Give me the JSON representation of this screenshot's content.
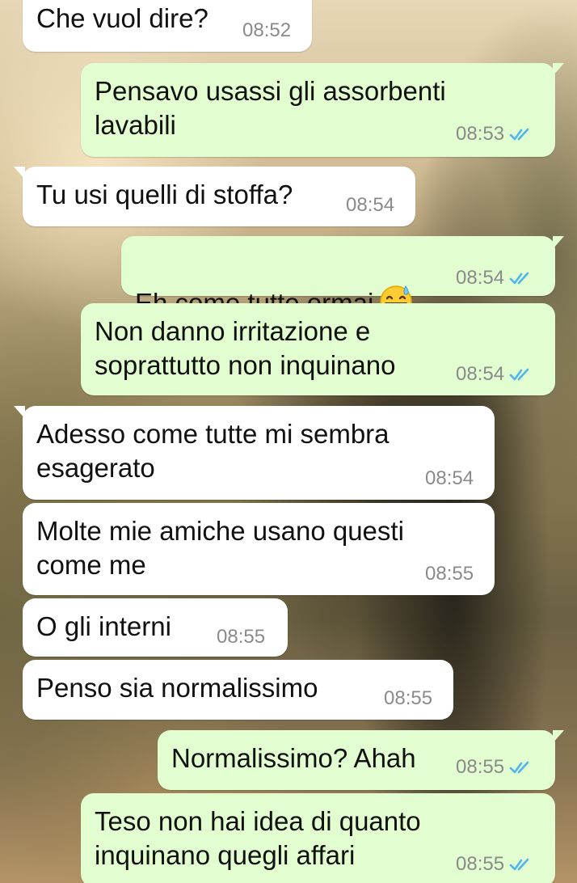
{
  "messages": [
    {
      "direction": "in",
      "text": "Che vuol dire?",
      "time": "08:52"
    },
    {
      "direction": "out",
      "text": "Pensavo usassi gli assorbenti\nlavabili",
      "time": "08:53",
      "read": true
    },
    {
      "direction": "in",
      "text": "Tu usi quelli di stoffa?",
      "time": "08:54"
    },
    {
      "direction": "out",
      "text": "Eh come tutte ormai",
      "emoji": "grinning-sweat-emoji",
      "time": "08:54",
      "read": true
    },
    {
      "direction": "out",
      "text": "Non danno irritazione e\nsoprattutto non inquinano",
      "time": "08:54",
      "read": true
    },
    {
      "direction": "in",
      "text": "Adesso come tutte mi sembra\nesagerato",
      "time": "08:54"
    },
    {
      "direction": "in",
      "text": "Molte mie amiche usano questi\ncome me",
      "time": "08:55"
    },
    {
      "direction": "in",
      "text": "O gli interni",
      "time": "08:55"
    },
    {
      "direction": "in",
      "text": "Penso sia normalissimo",
      "time": "08:55"
    },
    {
      "direction": "out",
      "text": "Normalissimo? Ahah",
      "time": "08:55",
      "read": true
    },
    {
      "direction": "out",
      "text": "Teso non hai idea di quanto\ninquinano quegli affari",
      "time": "08:55",
      "read": true
    }
  ],
  "colors": {
    "incoming_bubble": "#ffffff",
    "outgoing_bubble": "#e2fdd0",
    "read_ticks": "#4fb6ec",
    "timestamp": "#8a8a8a"
  }
}
